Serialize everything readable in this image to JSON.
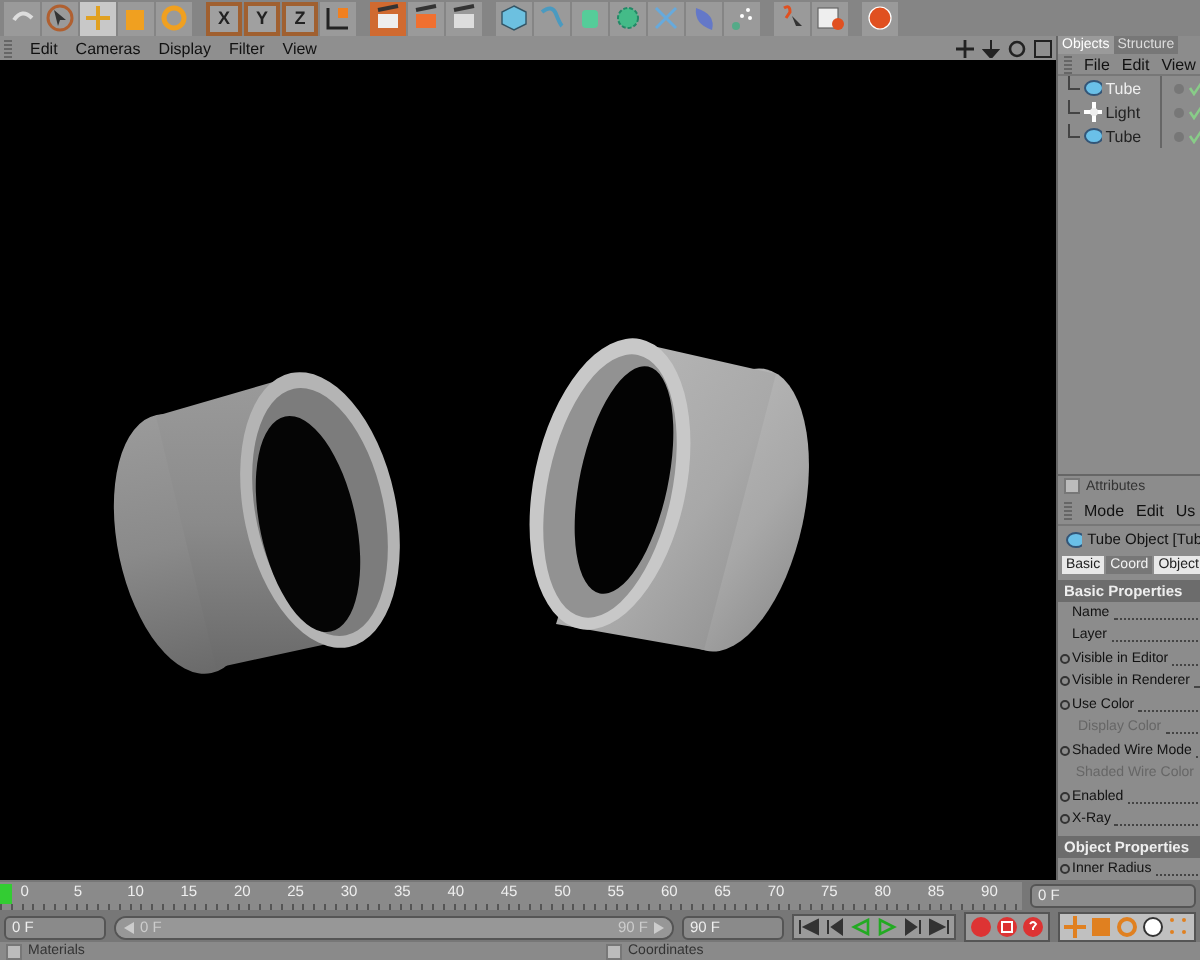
{
  "toolbar": {
    "axis_buttons": [
      "X",
      "Y",
      "Z"
    ]
  },
  "viewport_menu": [
    "Edit",
    "Cameras",
    "Display",
    "Filter",
    "View"
  ],
  "objects": {
    "tabs": [
      {
        "label": "Objects",
        "selected": true
      },
      {
        "label": "Structure",
        "selected": false
      }
    ],
    "menu": [
      "File",
      "Edit",
      "View"
    ],
    "items": [
      {
        "name": "Tube",
        "kind": "tube",
        "selected": true
      },
      {
        "name": "Light",
        "kind": "light",
        "selected": false
      },
      {
        "name": "Tube",
        "kind": "tube",
        "selected": false
      }
    ]
  },
  "attributes": {
    "title": "Attributes",
    "checked": false,
    "menu": [
      "Mode",
      "Edit",
      "Us"
    ],
    "object": "Tube Object [Tub",
    "tabs": [
      {
        "label": "Basic",
        "selected": true
      },
      {
        "label": "Coord",
        "selected": false
      },
      {
        "label": "Object",
        "selected": true
      }
    ],
    "sections": [
      {
        "title": "Basic Properties",
        "rows": [
          {
            "label": "Name",
            "animatable": false,
            "disabled": false
          },
          {
            "label": "Layer",
            "animatable": false,
            "disabled": false
          },
          {
            "label": "Visible in Editor",
            "animatable": true,
            "disabled": false
          },
          {
            "label": "Visible in Renderer",
            "animatable": true,
            "disabled": false
          },
          {
            "label": "Use Color",
            "animatable": true,
            "disabled": false
          },
          {
            "label": "Display Color",
            "animatable": false,
            "disabled": true
          },
          {
            "label": "Shaded Wire Mode",
            "animatable": true,
            "disabled": false
          },
          {
            "label": "Shaded Wire Color",
            "animatable": false,
            "disabled": true
          },
          {
            "label": "Enabled",
            "animatable": true,
            "disabled": false
          },
          {
            "label": "X-Ray",
            "animatable": true,
            "disabled": false
          }
        ]
      },
      {
        "title": "Object Properties",
        "rows": [
          {
            "label": "Inner Radius",
            "animatable": true,
            "disabled": false
          }
        ]
      }
    ]
  },
  "timeline": {
    "ticks": [
      "0",
      "5",
      "10",
      "15",
      "20",
      "25",
      "30",
      "35",
      "40",
      "45",
      "50",
      "55",
      "60",
      "65",
      "70",
      "75",
      "80",
      "85",
      "90"
    ],
    "playhead": {
      "level": 0
    },
    "current_frame": "0 F",
    "start_frame": "0 F",
    "range": {
      "level": 1
    },
    "range_start": "0 F",
    "range_end": "90 F",
    "end_frame": "90 F"
  },
  "bottom_panels": [
    {
      "title": "Materials",
      "checked": false
    },
    {
      "title": "Coordinates",
      "checked": false
    }
  ]
}
